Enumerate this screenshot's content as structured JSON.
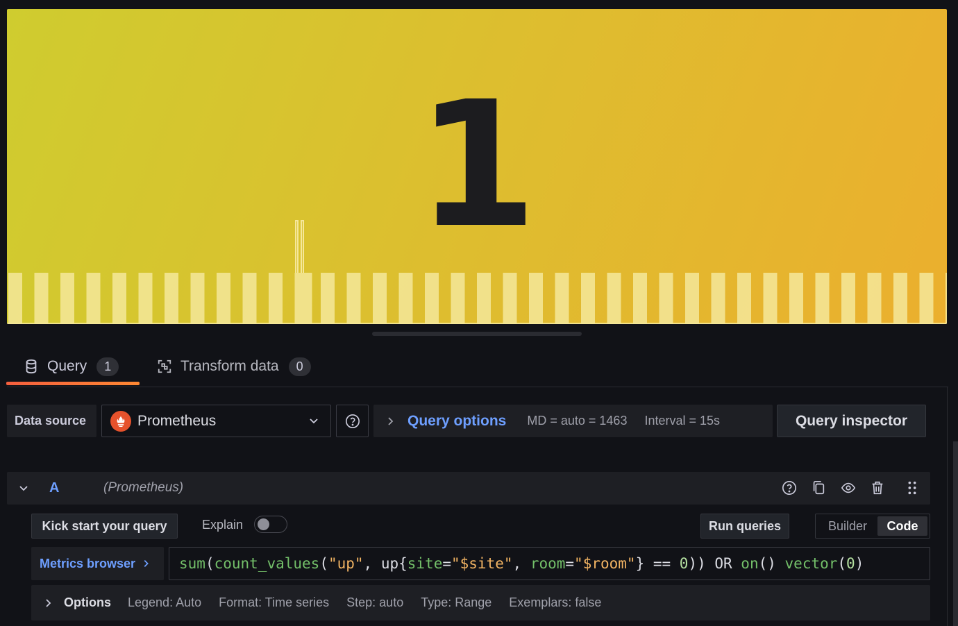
{
  "panel": {
    "stat_value": "1",
    "background_start": "#cfcc2f",
    "background_end": "#ebaf2e",
    "sparkline_color": "#f5e79a"
  },
  "tabs": [
    {
      "label": "Query",
      "count": "1",
      "icon": "database-icon"
    },
    {
      "label": "Transform data",
      "count": "0",
      "icon": "transform-icon"
    }
  ],
  "toolbar": {
    "data_source_label": "Data source",
    "data_source_value": "Prometheus",
    "query_options_label": "Query options",
    "md_info": "MD = auto = 1463",
    "interval_info": "Interval = 15s",
    "query_inspector_label": "Query inspector"
  },
  "query": {
    "ref_id": "A",
    "datasource": "(Prometheus)",
    "kick_start_label": "Kick start your query",
    "explain_label": "Explain",
    "run_queries_label": "Run queries",
    "mode_builder": "Builder",
    "mode_code": "Code",
    "metrics_browser_label": "Metrics browser",
    "expression": {
      "t1": "sum",
      "t2": "(",
      "t3": "count_values",
      "t4": "(",
      "t5": "\"up\"",
      "t6": ", up{",
      "t7": "site",
      "t8": "=",
      "t9": "\"$site\"",
      "t10": ", ",
      "t11": "room",
      "t12": "=",
      "t13": "\"$room\"",
      "t14": "} == ",
      "t15": "0",
      "t16": ")) OR ",
      "t17": "on",
      "t18": "() ",
      "t19": "vector",
      "t20": "(",
      "t21": "0",
      "t22": ")"
    }
  },
  "options": {
    "label": "Options",
    "legend": "Legend: Auto",
    "format": "Format: Time series",
    "step": "Step: auto",
    "type": "Type: Range",
    "exemplars": "Exemplars: false"
  }
}
